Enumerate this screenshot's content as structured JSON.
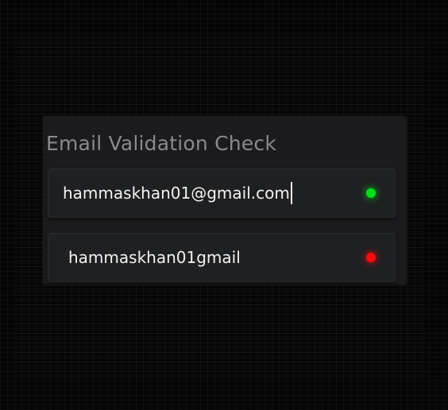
{
  "title": "Email Validation Check",
  "fields": [
    {
      "value": "hammaskhan01@gmail.com",
      "status": "valid",
      "status_color": "#00e01a",
      "status_icon": "green-status-dot-icon",
      "focused": true
    },
    {
      "value": "hammaskhan01gmail",
      "status": "invalid",
      "status_color": "#ff0a0a",
      "status_icon": "red-status-dot-icon",
      "focused": false
    }
  ],
  "colors": {
    "background": "#050505",
    "card": "#1b1b1d",
    "field": "#1f2022",
    "title": "#8a8a8c",
    "text": "#f2f2f2"
  }
}
